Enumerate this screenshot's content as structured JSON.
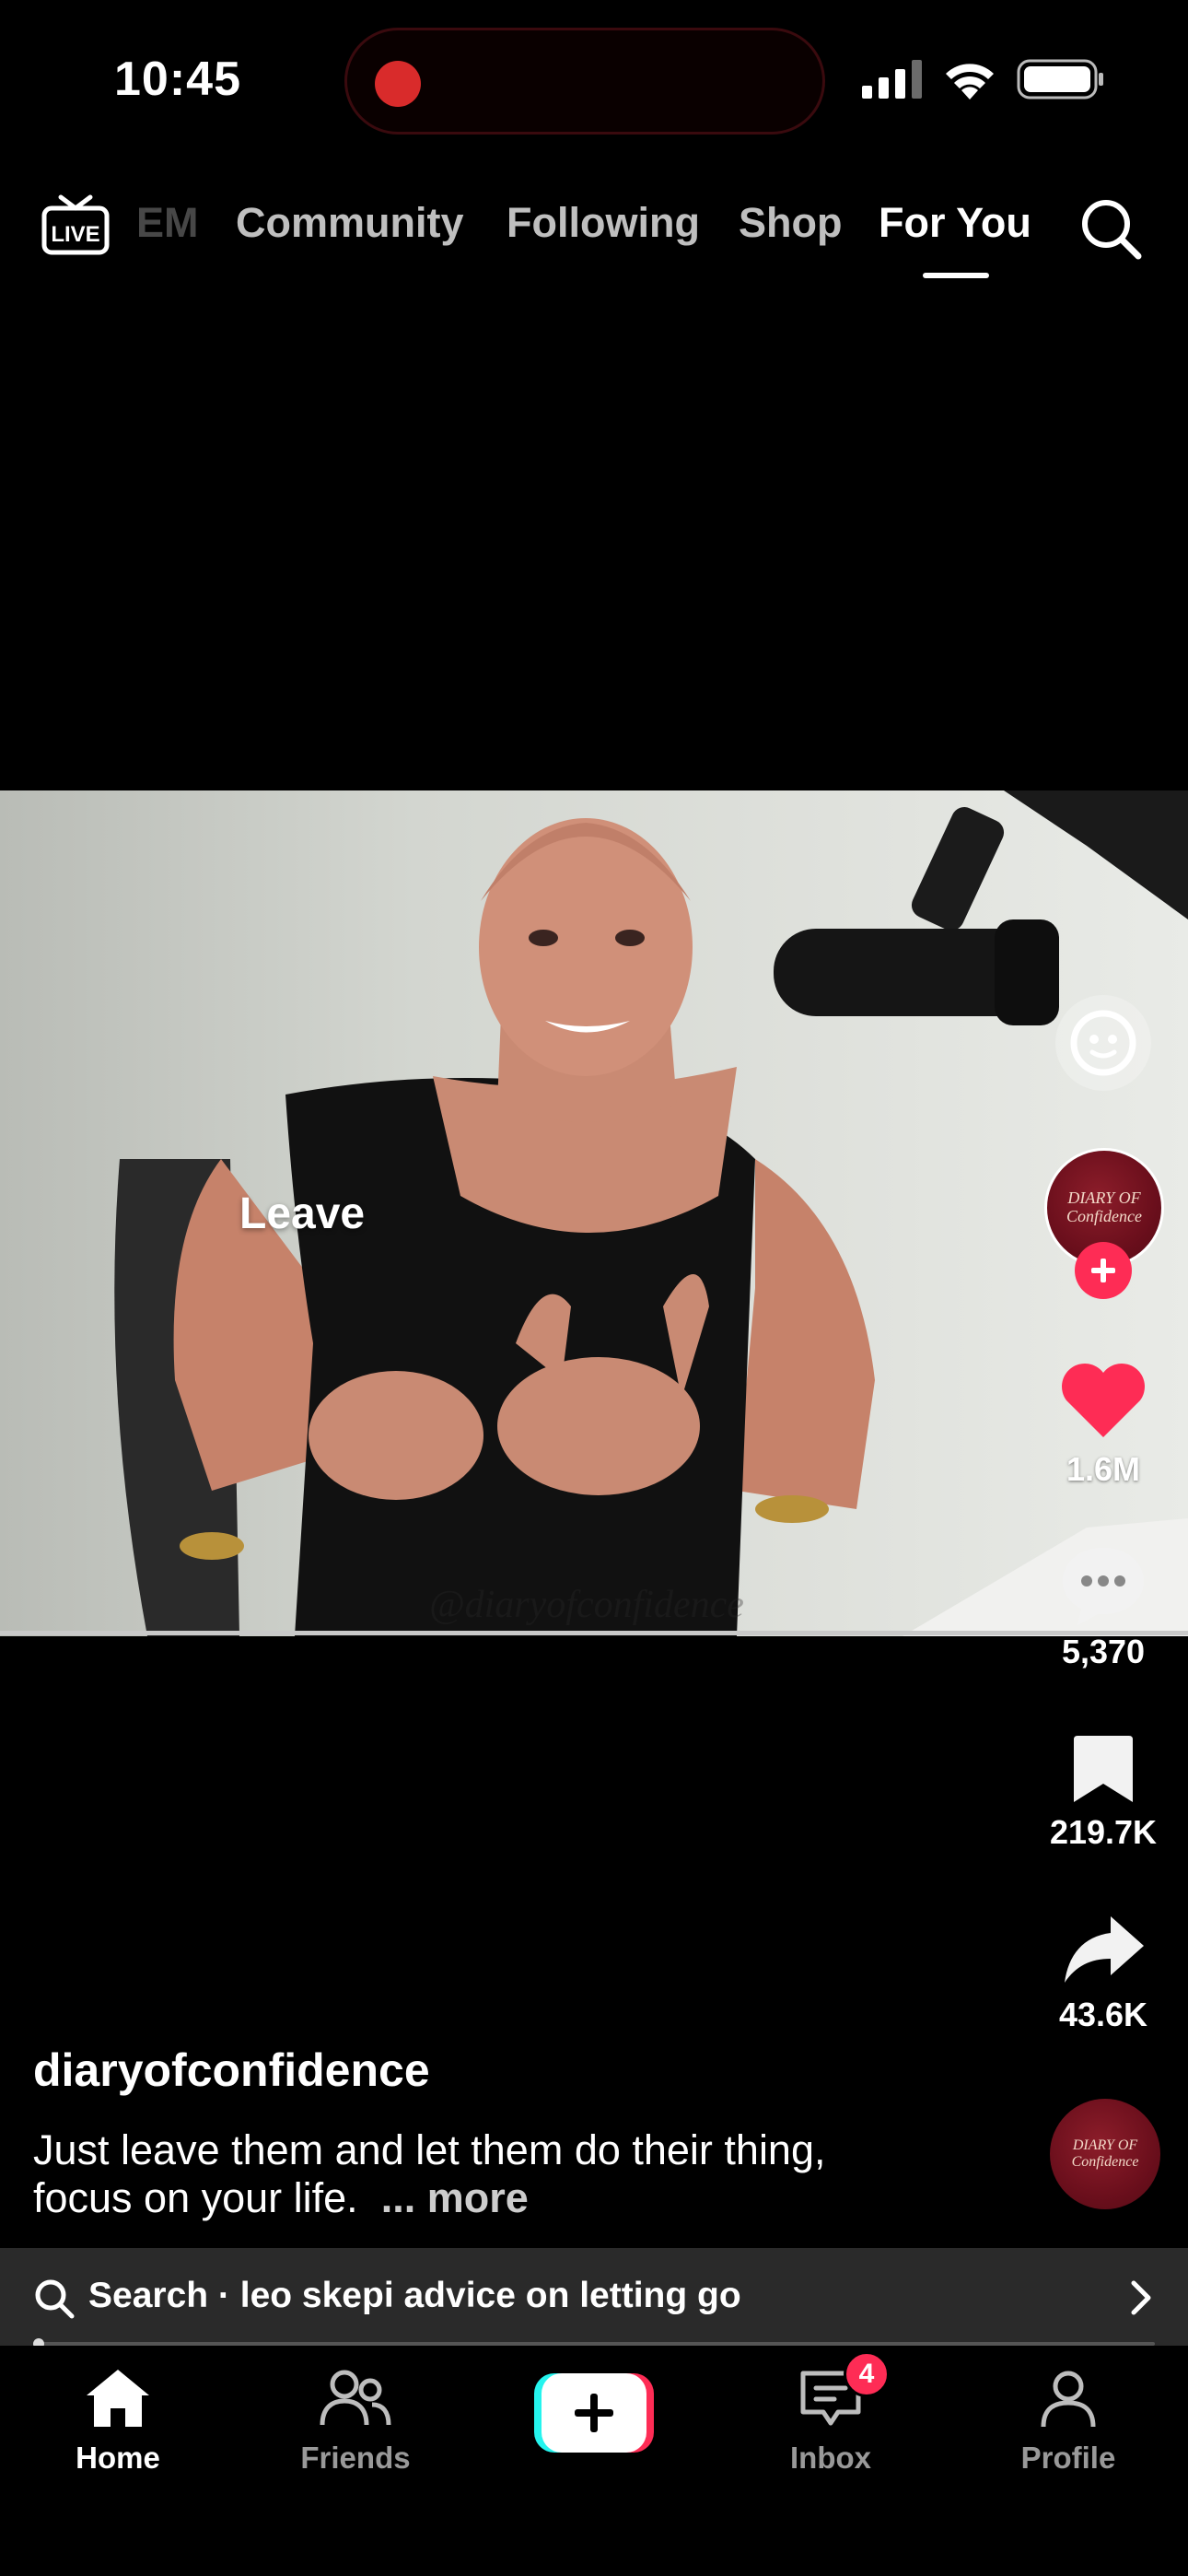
{
  "status_bar": {
    "time": "10:45"
  },
  "top_nav": {
    "tabs": [
      {
        "label": "EM",
        "state": "faded"
      },
      {
        "label": "Community",
        "state": "inactive"
      },
      {
        "label": "Following",
        "state": "inactive"
      },
      {
        "label": "Shop",
        "state": "inactive"
      },
      {
        "label": "For You",
        "state": "active"
      }
    ],
    "live_icon_text": "LIVE"
  },
  "video": {
    "caption_overlay": "Leave",
    "watermark": "@diaryofconfidence"
  },
  "actions": {
    "likes": "1.6M",
    "comments": "5,370",
    "saves": "219.7K",
    "shares": "43.6K",
    "avatar_text": "DIARY OF Confidence"
  },
  "post": {
    "username": "diaryofconfidence",
    "description": "Just leave them and let them do their thing, focus on your life.",
    "more_label": "... more"
  },
  "search_suggestion": {
    "text": "Search · leo skepi advice on letting go"
  },
  "playback": {
    "progress": 0.0
  },
  "tab_bar": {
    "home": "Home",
    "friends": "Friends",
    "inbox": "Inbox",
    "inbox_badge": "4",
    "profile": "Profile"
  },
  "colors": {
    "accent": "#fe2c55",
    "like": "#fe2c55",
    "create_cyan": "#25f4ee"
  }
}
